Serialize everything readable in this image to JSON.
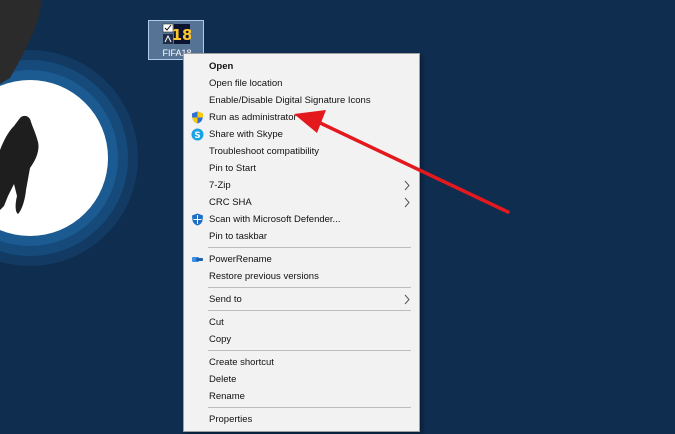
{
  "desktop": {
    "icon_label": "FIFA18",
    "icon_number": "18"
  },
  "context_menu": {
    "open": "Open",
    "open_file_location": "Open file location",
    "signature_icons": "Enable/Disable Digital Signature Icons",
    "run_as_admin": "Run as administrator",
    "share_skype": "Share with Skype",
    "troubleshoot": "Troubleshoot compatibility",
    "pin_start": "Pin to Start",
    "seven_zip": "7-Zip",
    "crc_sha": "CRC SHA",
    "scan_defender": "Scan with Microsoft Defender...",
    "pin_taskbar": "Pin to taskbar",
    "power_rename": "PowerRename",
    "restore_versions": "Restore previous versions",
    "send_to": "Send to",
    "cut": "Cut",
    "copy": "Copy",
    "create_shortcut": "Create shortcut",
    "delete": "Delete",
    "rename": "Rename",
    "properties": "Properties"
  },
  "colors": {
    "background": "#0e2d4f",
    "arrow": "#e3191d",
    "menu_bg": "#f2f2f2"
  },
  "icons": {
    "run_as_admin": "uac-shield-icon",
    "share_skype": "skype-icon",
    "scan_defender": "defender-shield-icon",
    "power_rename": "powerrename-icon",
    "submenu": "chevron-right-icon"
  }
}
